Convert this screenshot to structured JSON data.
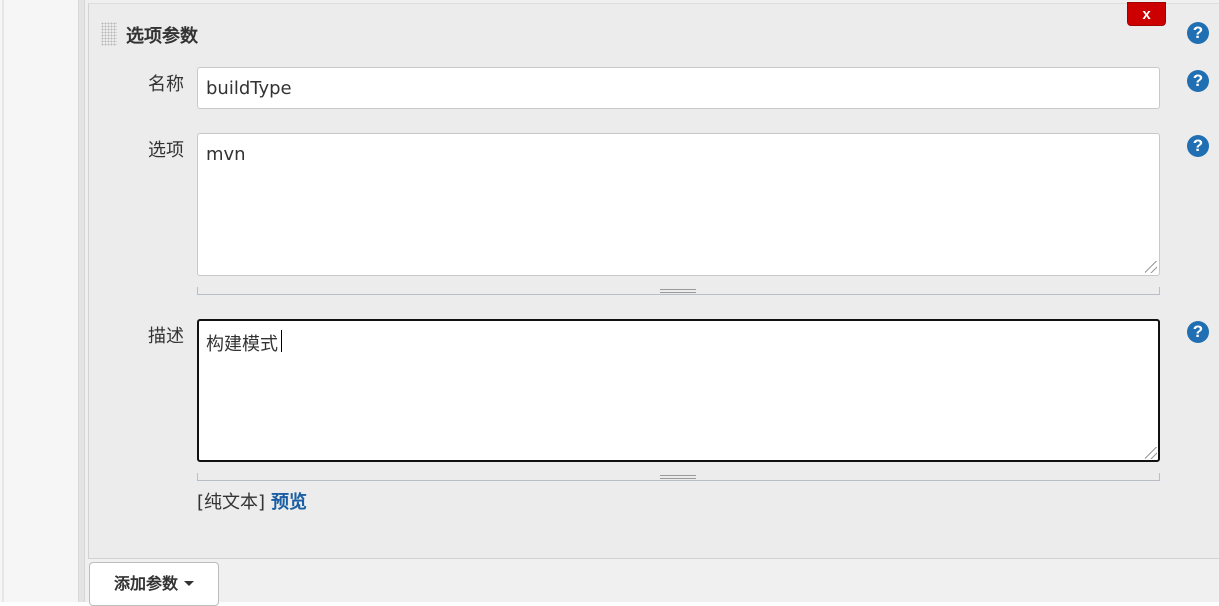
{
  "parameter": {
    "title": "选项参数",
    "delete_label": "x",
    "help_label": "?",
    "name": {
      "label": "名称",
      "value": "buildType"
    },
    "choices": {
      "label": "选项",
      "value": "mvn"
    },
    "description": {
      "label": "描述",
      "value": "构建模式"
    },
    "preview": {
      "format_text": "[纯文本]",
      "link_label": "预览"
    }
  },
  "add_parameter": {
    "label": "添加参数"
  },
  "colors": {
    "delete_red": "#cc0000",
    "help_blue": "#1f6fb2",
    "link_blue": "#1a5fa3",
    "panel_gray": "#ececec"
  }
}
